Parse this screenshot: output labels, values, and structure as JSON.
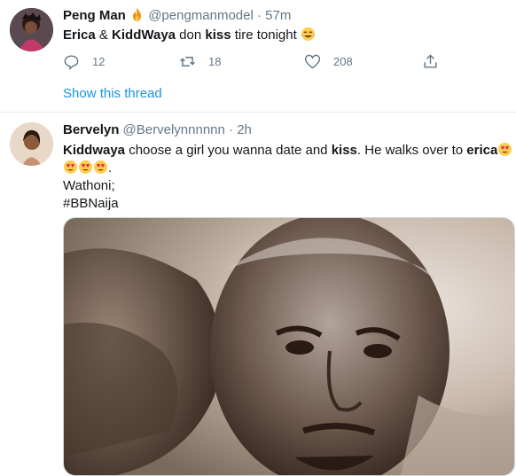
{
  "tweet1": {
    "name": "Peng Man",
    "handle": "@pengmanmodel",
    "time": "57m",
    "text": {
      "p1": "Erica",
      "p2": " & ",
      "p3": "KiddWaya",
      "p4": " don ",
      "p5": "kiss",
      "p6": " tire tonight "
    },
    "replies": "12",
    "retweets": "18",
    "likes": "208",
    "show_thread": "Show this thread"
  },
  "tweet2": {
    "name": "Bervelyn",
    "handle": "@Bervelynnnnnn",
    "time": "2h",
    "text": {
      "p1": "Kiddwaya",
      "p2": " choose a girl you wanna date and ",
      "p3": "kiss",
      "p4": ". He walks over to ",
      "p5": "erica",
      "line3": "Wathoni;",
      "hashtag": "#BBNaija"
    }
  },
  "icons": {
    "reply": "reply-icon",
    "retweet": "retweet-icon",
    "like": "heart-icon",
    "share": "share-icon",
    "fire": "fire-emoji",
    "laugh": "tears-of-joy-emoji",
    "heart_eyes": "heart-eyes-emoji"
  },
  "colors": {
    "link": "#1b95e0",
    "secondary_text": "#657786",
    "name_text": "#14171a"
  }
}
